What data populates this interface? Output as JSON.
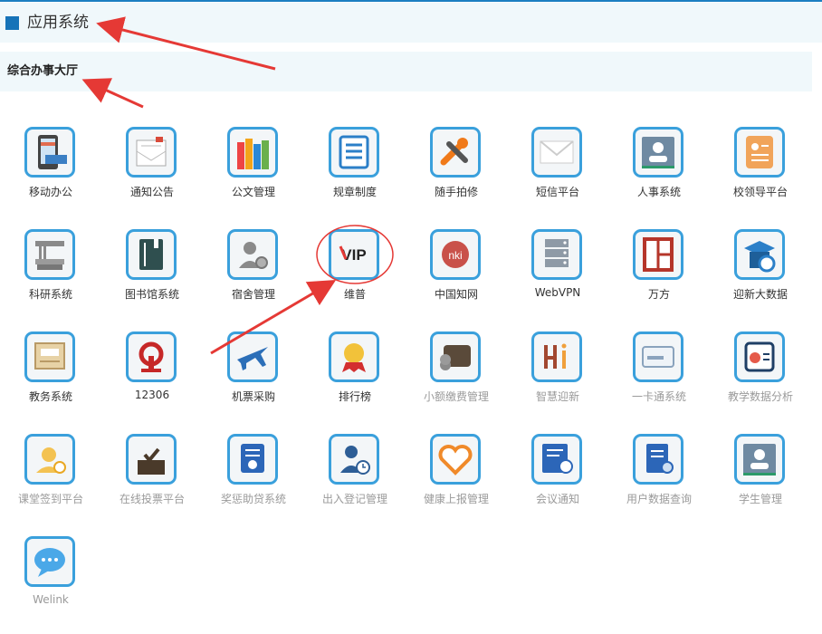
{
  "header": {
    "title": "应用系统"
  },
  "section": {
    "title": "综合办事大厅"
  },
  "apps": [
    {
      "label": "移动办公",
      "icon": "mobile-office-icon",
      "dim": false
    },
    {
      "label": "通知公告",
      "icon": "notice-mail-icon",
      "dim": false
    },
    {
      "label": "公文管理",
      "icon": "document-binders-icon",
      "dim": false
    },
    {
      "label": "规章制度",
      "icon": "rules-list-icon",
      "dim": false
    },
    {
      "label": "随手拍修",
      "icon": "repair-tools-icon",
      "dim": false
    },
    {
      "label": "短信平台",
      "icon": "envelope-icon",
      "dim": false
    },
    {
      "label": "人事系统",
      "icon": "personnel-card-icon",
      "dim": false
    },
    {
      "label": "校领导平台",
      "icon": "leader-card-icon",
      "dim": false
    },
    {
      "label": "科研系统",
      "icon": "books-stack-icon",
      "dim": false
    },
    {
      "label": "图书馆系统",
      "icon": "library-book-icon",
      "dim": false
    },
    {
      "label": "宿舍管理",
      "icon": "dorm-user-gear-icon",
      "dim": false
    },
    {
      "label": "维普",
      "icon": "vip-logo-icon",
      "dim": false
    },
    {
      "label": "中国知网",
      "icon": "cnki-logo-icon",
      "dim": false
    },
    {
      "label": "WebVPN",
      "icon": "server-rack-icon",
      "dim": false
    },
    {
      "label": "万方",
      "icon": "wanfang-logo-icon",
      "dim": false
    },
    {
      "label": "迎新大数据",
      "icon": "graduation-data-icon",
      "dim": false
    },
    {
      "label": "教务系统",
      "icon": "academic-frame-icon",
      "dim": false
    },
    {
      "label": "12306",
      "icon": "railway-logo-icon",
      "dim": false
    },
    {
      "label": "机票采购",
      "icon": "airplane-icon",
      "dim": false
    },
    {
      "label": "排行榜",
      "icon": "medal-ranking-icon",
      "dim": false
    },
    {
      "label": "小额缴费管理",
      "icon": "wallet-coins-icon",
      "dim": true
    },
    {
      "label": "智慧迎新",
      "icon": "hi-logo-icon",
      "dim": true
    },
    {
      "label": "一卡通系统",
      "icon": "campus-card-icon",
      "dim": true
    },
    {
      "label": "教学数据分析",
      "icon": "teaching-chart-icon",
      "dim": true
    },
    {
      "label": "课堂签到平台",
      "icon": "checkin-user-icon",
      "dim": true
    },
    {
      "label": "在线投票平台",
      "icon": "vote-box-icon",
      "dim": true
    },
    {
      "label": "奖惩助贷系统",
      "icon": "award-document-icon",
      "dim": true
    },
    {
      "label": "出入登记管理",
      "icon": "access-user-clock-icon",
      "dim": true
    },
    {
      "label": "健康上报管理",
      "icon": "health-heart-icon",
      "dim": true
    },
    {
      "label": "会议通知",
      "icon": "meeting-notice-icon",
      "dim": true
    },
    {
      "label": "用户数据查询",
      "icon": "user-data-search-icon",
      "dim": true
    },
    {
      "label": "学生管理",
      "icon": "student-card-icon",
      "dim": true
    },
    {
      "label": "Welink",
      "icon": "chat-bubble-icon",
      "dim": true
    }
  ],
  "colors": {
    "accent": "#1673b8",
    "tile_border": "#3aa0dc",
    "annotation": "#e53935"
  }
}
